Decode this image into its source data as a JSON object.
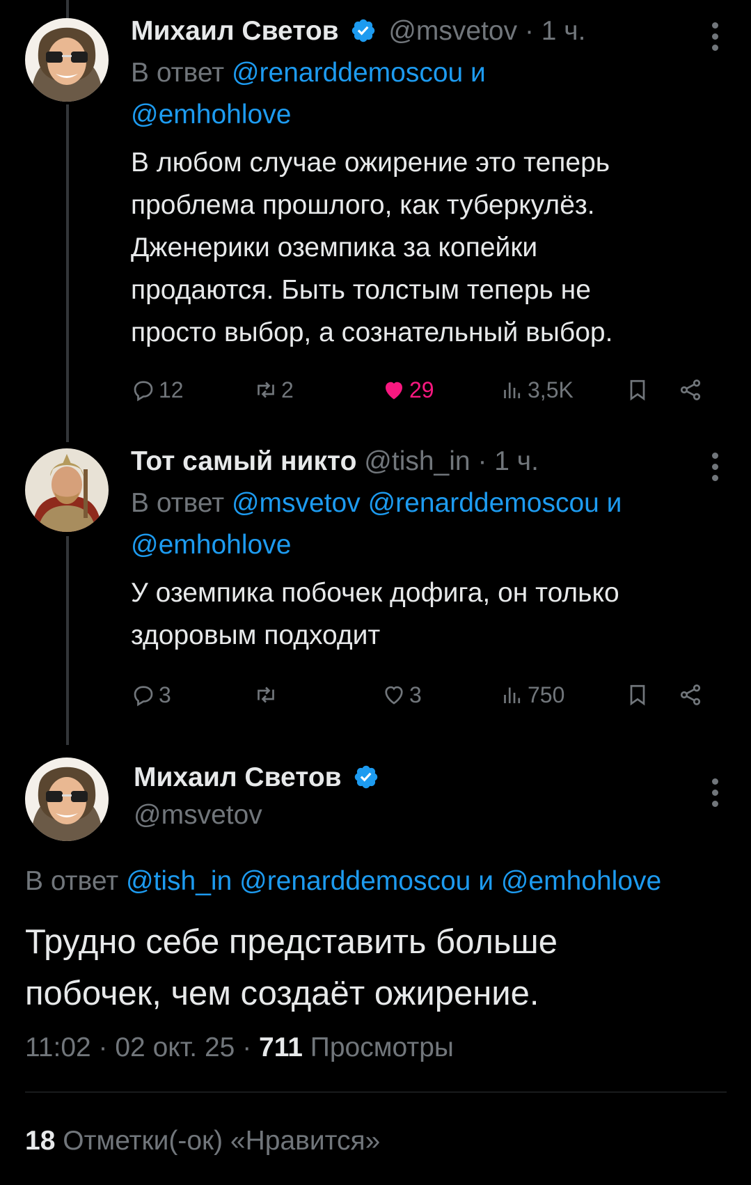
{
  "tweets": [
    {
      "name": "Михаил Светов",
      "handle": "@msvetov",
      "time": "· 1 ч.",
      "reply_prefix": "В ответ",
      "reply_mentions_line1": "@renarddemoscou и",
      "reply_mentions_line2": "@emhohlove",
      "text_lines": [
        "В любом случае ожирение это теперь",
        "проблема прошлого, как туберкулёз.",
        "Дженерики оземпика за копейки",
        "продаются. Быть толстым теперь не",
        "просто выбор, а сознательный выбор."
      ],
      "replies": "12",
      "reposts": "2",
      "likes": "29",
      "views": "3,5K",
      "liked": true
    },
    {
      "name": "Тот самый никто",
      "handle": "@tish_in",
      "time": "· 1 ч.",
      "reply_prefix": "В ответ",
      "reply_mentions_line1": "@msvetov @renarddemoscou и",
      "reply_mentions_line2": "@emhohlove",
      "text_lines": [
        "У оземпика побочек дофига, он только",
        "здоровым подходит"
      ],
      "replies": "3",
      "reposts": "",
      "likes": "3",
      "views": "750",
      "liked": false
    }
  ],
  "main": {
    "name": "Михаил Светов",
    "handle": "@msvetov",
    "reply_prefix": "В ответ",
    "reply_mentions": "@tish_in @renarddemoscou и @emhohlove",
    "text_lines": [
      "Трудно себе представить больше",
      "побочек, чем создаёт ожирение."
    ],
    "time": "11:02 · 02 окт. 25 ·",
    "views_count": "711",
    "views_label": "Просмотры",
    "likes_count": "18",
    "likes_label": "Отметки(-ок) «Нравится»"
  },
  "colors": {
    "accent": "#1d9bf0",
    "like": "#f91880",
    "muted": "#71767b",
    "text": "#e7e9ea"
  },
  "icons": [
    "verified-badge-icon",
    "more-icon",
    "reply-icon",
    "repost-icon",
    "like-icon",
    "views-icon",
    "bookmark-icon",
    "share-icon"
  ]
}
